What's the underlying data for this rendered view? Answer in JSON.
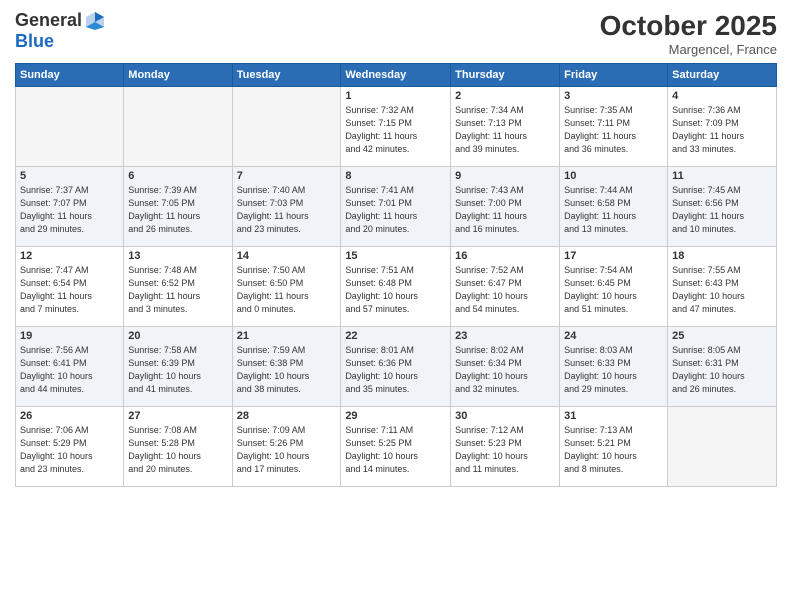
{
  "header": {
    "logo_line1": "General",
    "logo_line2": "Blue",
    "month": "October 2025",
    "location": "Margencel, France"
  },
  "weekdays": [
    "Sunday",
    "Monday",
    "Tuesday",
    "Wednesday",
    "Thursday",
    "Friday",
    "Saturday"
  ],
  "weeks": [
    [
      {
        "day": "",
        "info": ""
      },
      {
        "day": "",
        "info": ""
      },
      {
        "day": "",
        "info": ""
      },
      {
        "day": "1",
        "info": "Sunrise: 7:32 AM\nSunset: 7:15 PM\nDaylight: 11 hours\nand 42 minutes."
      },
      {
        "day": "2",
        "info": "Sunrise: 7:34 AM\nSunset: 7:13 PM\nDaylight: 11 hours\nand 39 minutes."
      },
      {
        "day": "3",
        "info": "Sunrise: 7:35 AM\nSunset: 7:11 PM\nDaylight: 11 hours\nand 36 minutes."
      },
      {
        "day": "4",
        "info": "Sunrise: 7:36 AM\nSunset: 7:09 PM\nDaylight: 11 hours\nand 33 minutes."
      }
    ],
    [
      {
        "day": "5",
        "info": "Sunrise: 7:37 AM\nSunset: 7:07 PM\nDaylight: 11 hours\nand 29 minutes."
      },
      {
        "day": "6",
        "info": "Sunrise: 7:39 AM\nSunset: 7:05 PM\nDaylight: 11 hours\nand 26 minutes."
      },
      {
        "day": "7",
        "info": "Sunrise: 7:40 AM\nSunset: 7:03 PM\nDaylight: 11 hours\nand 23 minutes."
      },
      {
        "day": "8",
        "info": "Sunrise: 7:41 AM\nSunset: 7:01 PM\nDaylight: 11 hours\nand 20 minutes."
      },
      {
        "day": "9",
        "info": "Sunrise: 7:43 AM\nSunset: 7:00 PM\nDaylight: 11 hours\nand 16 minutes."
      },
      {
        "day": "10",
        "info": "Sunrise: 7:44 AM\nSunset: 6:58 PM\nDaylight: 11 hours\nand 13 minutes."
      },
      {
        "day": "11",
        "info": "Sunrise: 7:45 AM\nSunset: 6:56 PM\nDaylight: 11 hours\nand 10 minutes."
      }
    ],
    [
      {
        "day": "12",
        "info": "Sunrise: 7:47 AM\nSunset: 6:54 PM\nDaylight: 11 hours\nand 7 minutes."
      },
      {
        "day": "13",
        "info": "Sunrise: 7:48 AM\nSunset: 6:52 PM\nDaylight: 11 hours\nand 3 minutes."
      },
      {
        "day": "14",
        "info": "Sunrise: 7:50 AM\nSunset: 6:50 PM\nDaylight: 11 hours\nand 0 minutes."
      },
      {
        "day": "15",
        "info": "Sunrise: 7:51 AM\nSunset: 6:48 PM\nDaylight: 10 hours\nand 57 minutes."
      },
      {
        "day": "16",
        "info": "Sunrise: 7:52 AM\nSunset: 6:47 PM\nDaylight: 10 hours\nand 54 minutes."
      },
      {
        "day": "17",
        "info": "Sunrise: 7:54 AM\nSunset: 6:45 PM\nDaylight: 10 hours\nand 51 minutes."
      },
      {
        "day": "18",
        "info": "Sunrise: 7:55 AM\nSunset: 6:43 PM\nDaylight: 10 hours\nand 47 minutes."
      }
    ],
    [
      {
        "day": "19",
        "info": "Sunrise: 7:56 AM\nSunset: 6:41 PM\nDaylight: 10 hours\nand 44 minutes."
      },
      {
        "day": "20",
        "info": "Sunrise: 7:58 AM\nSunset: 6:39 PM\nDaylight: 10 hours\nand 41 minutes."
      },
      {
        "day": "21",
        "info": "Sunrise: 7:59 AM\nSunset: 6:38 PM\nDaylight: 10 hours\nand 38 minutes."
      },
      {
        "day": "22",
        "info": "Sunrise: 8:01 AM\nSunset: 6:36 PM\nDaylight: 10 hours\nand 35 minutes."
      },
      {
        "day": "23",
        "info": "Sunrise: 8:02 AM\nSunset: 6:34 PM\nDaylight: 10 hours\nand 32 minutes."
      },
      {
        "day": "24",
        "info": "Sunrise: 8:03 AM\nSunset: 6:33 PM\nDaylight: 10 hours\nand 29 minutes."
      },
      {
        "day": "25",
        "info": "Sunrise: 8:05 AM\nSunset: 6:31 PM\nDaylight: 10 hours\nand 26 minutes."
      }
    ],
    [
      {
        "day": "26",
        "info": "Sunrise: 7:06 AM\nSunset: 5:29 PM\nDaylight: 10 hours\nand 23 minutes."
      },
      {
        "day": "27",
        "info": "Sunrise: 7:08 AM\nSunset: 5:28 PM\nDaylight: 10 hours\nand 20 minutes."
      },
      {
        "day": "28",
        "info": "Sunrise: 7:09 AM\nSunset: 5:26 PM\nDaylight: 10 hours\nand 17 minutes."
      },
      {
        "day": "29",
        "info": "Sunrise: 7:11 AM\nSunset: 5:25 PM\nDaylight: 10 hours\nand 14 minutes."
      },
      {
        "day": "30",
        "info": "Sunrise: 7:12 AM\nSunset: 5:23 PM\nDaylight: 10 hours\nand 11 minutes."
      },
      {
        "day": "31",
        "info": "Sunrise: 7:13 AM\nSunset: 5:21 PM\nDaylight: 10 hours\nand 8 minutes."
      },
      {
        "day": "",
        "info": ""
      }
    ]
  ]
}
